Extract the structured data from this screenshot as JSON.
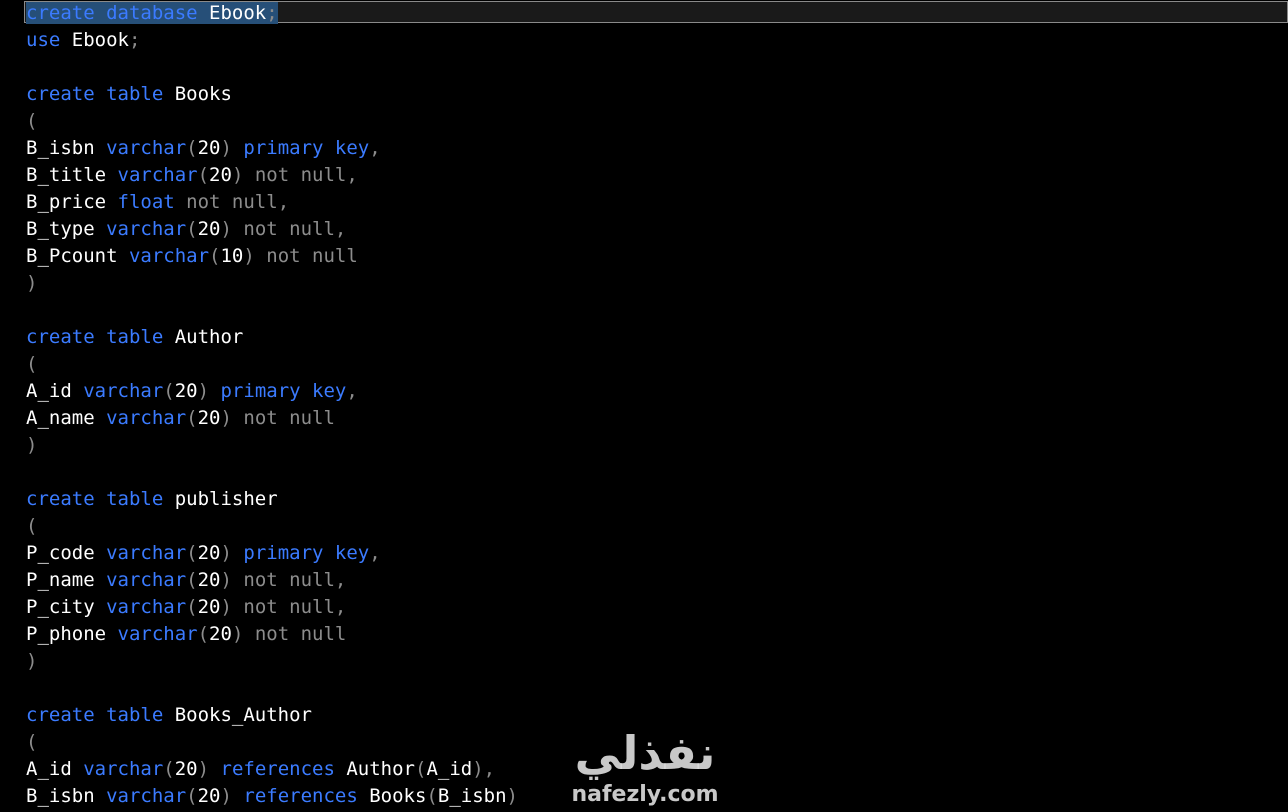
{
  "editor": {
    "lines": [
      [
        {
          "t": "create database",
          "c": "kw",
          "sel": true
        },
        {
          "t": " ",
          "c": "id",
          "sel": true
        },
        {
          "t": "Ebook",
          "c": "id",
          "sel": true
        },
        {
          "t": ";",
          "c": "p",
          "sel": true
        }
      ],
      [
        {
          "t": "use",
          "c": "kw"
        },
        {
          "t": " Ebook",
          "c": "id"
        },
        {
          "t": ";",
          "c": "p"
        }
      ],
      [],
      [
        {
          "t": "create table",
          "c": "kw"
        },
        {
          "t": " Books",
          "c": "id"
        }
      ],
      [
        {
          "t": "(",
          "c": "p"
        }
      ],
      [
        {
          "t": "B_isbn ",
          "c": "id"
        },
        {
          "t": "varchar",
          "c": "kw"
        },
        {
          "t": "(",
          "c": "p"
        },
        {
          "t": "20",
          "c": "num"
        },
        {
          "t": ") ",
          "c": "p"
        },
        {
          "t": "primary key",
          "c": "kw"
        },
        {
          "t": ",",
          "c": "p"
        }
      ],
      [
        {
          "t": "B_title ",
          "c": "id"
        },
        {
          "t": "varchar",
          "c": "kw"
        },
        {
          "t": "(",
          "c": "p"
        },
        {
          "t": "20",
          "c": "num"
        },
        {
          "t": ") ",
          "c": "p"
        },
        {
          "t": "not null",
          "c": "nn"
        },
        {
          "t": ",",
          "c": "p"
        }
      ],
      [
        {
          "t": "B_price ",
          "c": "id"
        },
        {
          "t": "float",
          "c": "kw"
        },
        {
          "t": " ",
          "c": "p"
        },
        {
          "t": "not null",
          "c": "nn"
        },
        {
          "t": ",",
          "c": "p"
        }
      ],
      [
        {
          "t": "B_type ",
          "c": "id"
        },
        {
          "t": "varchar",
          "c": "kw"
        },
        {
          "t": "(",
          "c": "p"
        },
        {
          "t": "20",
          "c": "num"
        },
        {
          "t": ") ",
          "c": "p"
        },
        {
          "t": "not null",
          "c": "nn"
        },
        {
          "t": ",",
          "c": "p"
        }
      ],
      [
        {
          "t": "B_Pcount ",
          "c": "id"
        },
        {
          "t": "varchar",
          "c": "kw"
        },
        {
          "t": "(",
          "c": "p"
        },
        {
          "t": "10",
          "c": "num"
        },
        {
          "t": ") ",
          "c": "p"
        },
        {
          "t": "not null",
          "c": "nn"
        }
      ],
      [
        {
          "t": ")",
          "c": "p"
        }
      ],
      [],
      [
        {
          "t": "create table",
          "c": "kw"
        },
        {
          "t": " Author",
          "c": "id"
        }
      ],
      [
        {
          "t": "(",
          "c": "p"
        }
      ],
      [
        {
          "t": "A_id ",
          "c": "id"
        },
        {
          "t": "varchar",
          "c": "kw"
        },
        {
          "t": "(",
          "c": "p"
        },
        {
          "t": "20",
          "c": "num"
        },
        {
          "t": ") ",
          "c": "p"
        },
        {
          "t": "primary key",
          "c": "kw"
        },
        {
          "t": ",",
          "c": "p"
        }
      ],
      [
        {
          "t": "A_name ",
          "c": "id"
        },
        {
          "t": "varchar",
          "c": "kw"
        },
        {
          "t": "(",
          "c": "p"
        },
        {
          "t": "20",
          "c": "num"
        },
        {
          "t": ") ",
          "c": "p"
        },
        {
          "t": "not null",
          "c": "nn"
        }
      ],
      [
        {
          "t": ")",
          "c": "p"
        }
      ],
      [],
      [
        {
          "t": "create table",
          "c": "kw"
        },
        {
          "t": " publisher",
          "c": "id"
        }
      ],
      [
        {
          "t": "(",
          "c": "p"
        }
      ],
      [
        {
          "t": "P_code ",
          "c": "id"
        },
        {
          "t": "varchar",
          "c": "kw"
        },
        {
          "t": "(",
          "c": "p"
        },
        {
          "t": "20",
          "c": "num"
        },
        {
          "t": ") ",
          "c": "p"
        },
        {
          "t": "primary key",
          "c": "kw"
        },
        {
          "t": ",",
          "c": "p"
        }
      ],
      [
        {
          "t": "P_name ",
          "c": "id"
        },
        {
          "t": "varchar",
          "c": "kw"
        },
        {
          "t": "(",
          "c": "p"
        },
        {
          "t": "20",
          "c": "num"
        },
        {
          "t": ") ",
          "c": "p"
        },
        {
          "t": "not null",
          "c": "nn"
        },
        {
          "t": ",",
          "c": "p"
        }
      ],
      [
        {
          "t": "P_city ",
          "c": "id"
        },
        {
          "t": "varchar",
          "c": "kw"
        },
        {
          "t": "(",
          "c": "p"
        },
        {
          "t": "20",
          "c": "num"
        },
        {
          "t": ") ",
          "c": "p"
        },
        {
          "t": "not null",
          "c": "nn"
        },
        {
          "t": ",",
          "c": "p"
        }
      ],
      [
        {
          "t": "P_phone ",
          "c": "id"
        },
        {
          "t": "varchar",
          "c": "kw"
        },
        {
          "t": "(",
          "c": "p"
        },
        {
          "t": "20",
          "c": "num"
        },
        {
          "t": ") ",
          "c": "p"
        },
        {
          "t": "not null",
          "c": "nn"
        }
      ],
      [
        {
          "t": ")",
          "c": "p"
        }
      ],
      [],
      [
        {
          "t": "create table",
          "c": "kw"
        },
        {
          "t": " Books_Author",
          "c": "id"
        }
      ],
      [
        {
          "t": "(",
          "c": "p"
        }
      ],
      [
        {
          "t": "A_id ",
          "c": "id"
        },
        {
          "t": "varchar",
          "c": "kw"
        },
        {
          "t": "(",
          "c": "p"
        },
        {
          "t": "20",
          "c": "num"
        },
        {
          "t": ") ",
          "c": "p"
        },
        {
          "t": "references",
          "c": "kw"
        },
        {
          "t": " Author",
          "c": "id"
        },
        {
          "t": "(",
          "c": "p"
        },
        {
          "t": "A_id",
          "c": "id"
        },
        {
          "t": "),",
          "c": "p"
        }
      ],
      [
        {
          "t": "B_isbn ",
          "c": "id"
        },
        {
          "t": "varchar",
          "c": "kw"
        },
        {
          "t": "(",
          "c": "p"
        },
        {
          "t": "20",
          "c": "num"
        },
        {
          "t": ") ",
          "c": "p"
        },
        {
          "t": "references",
          "c": "kw"
        },
        {
          "t": " Books",
          "c": "id"
        },
        {
          "t": "(",
          "c": "p"
        },
        {
          "t": "B_isbn",
          "c": "id"
        },
        {
          "t": ")",
          "c": "p"
        }
      ]
    ]
  },
  "watermark": {
    "arabic": "نفذلي",
    "latin": "nafezly.com"
  }
}
